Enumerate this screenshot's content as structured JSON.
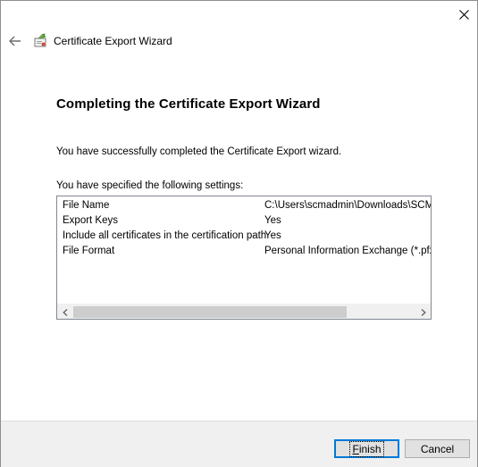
{
  "window": {
    "title": "Certificate Export Wizard",
    "close_icon": "close-icon",
    "back_icon": "back-arrow-icon",
    "app_icon": "certificate-icon"
  },
  "main": {
    "heading": "Completing the Certificate Export Wizard",
    "message": "You have successfully completed the Certificate Export wizard.",
    "settings_label": "You have specified the following settings:",
    "settings": [
      {
        "name": "File Name",
        "value": "C:\\Users\\scmadmin\\Downloads\\SCM.C"
      },
      {
        "name": "Export Keys",
        "value": "Yes"
      },
      {
        "name": "Include all certificates in the certification path",
        "value": "Yes"
      },
      {
        "name": "File Format",
        "value": "Personal Information Exchange (*.pfx)"
      }
    ],
    "scroll_left_icon": "chevron-left-icon",
    "scroll_right_icon": "chevron-right-icon",
    "scroll_position": 0.0
  },
  "buttons": {
    "finish_accel": "F",
    "finish_rest": "inish",
    "cancel": "Cancel"
  },
  "colors": {
    "focus_blue": "#0078d7",
    "footer_bg": "#f0f0f0",
    "button_bg": "#e1e1e1"
  }
}
